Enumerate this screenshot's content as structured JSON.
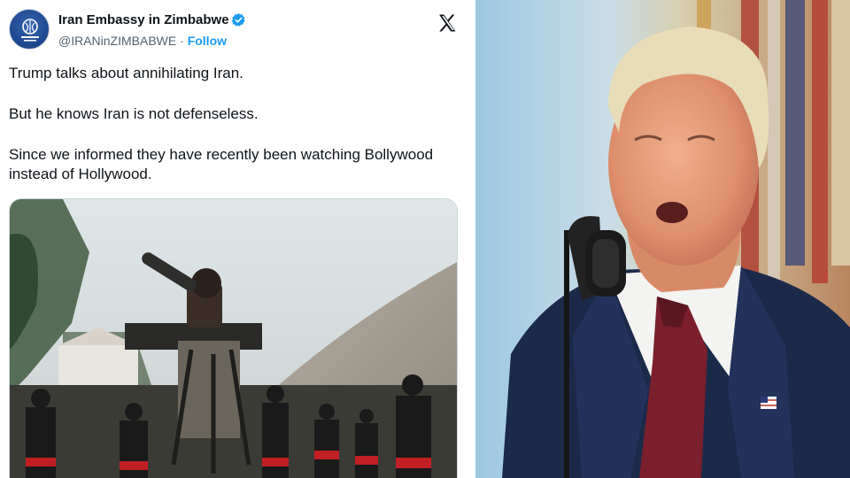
{
  "tweet": {
    "display_name": "Iran Embassy in Zimbabwe",
    "handle": "@IRANinZIMBABWE",
    "separator": "·",
    "follow_label": "Follow",
    "verified_icon": "verified-badge-icon",
    "brand_icon": "x-logo-icon",
    "paragraphs": [
      "Trump talks about annihilating Iran.",
      "But he knows Iran is not defenseless.",
      "Since we informed they have recently been watching Bollywood instead of Hollywood."
    ],
    "media_alt": "video-still"
  },
  "colors": {
    "link": "#1d9bf0",
    "text": "#0f1419",
    "secondary": "#536471",
    "suit": "#1c2a4a",
    "tie": "#7a1f2b"
  }
}
